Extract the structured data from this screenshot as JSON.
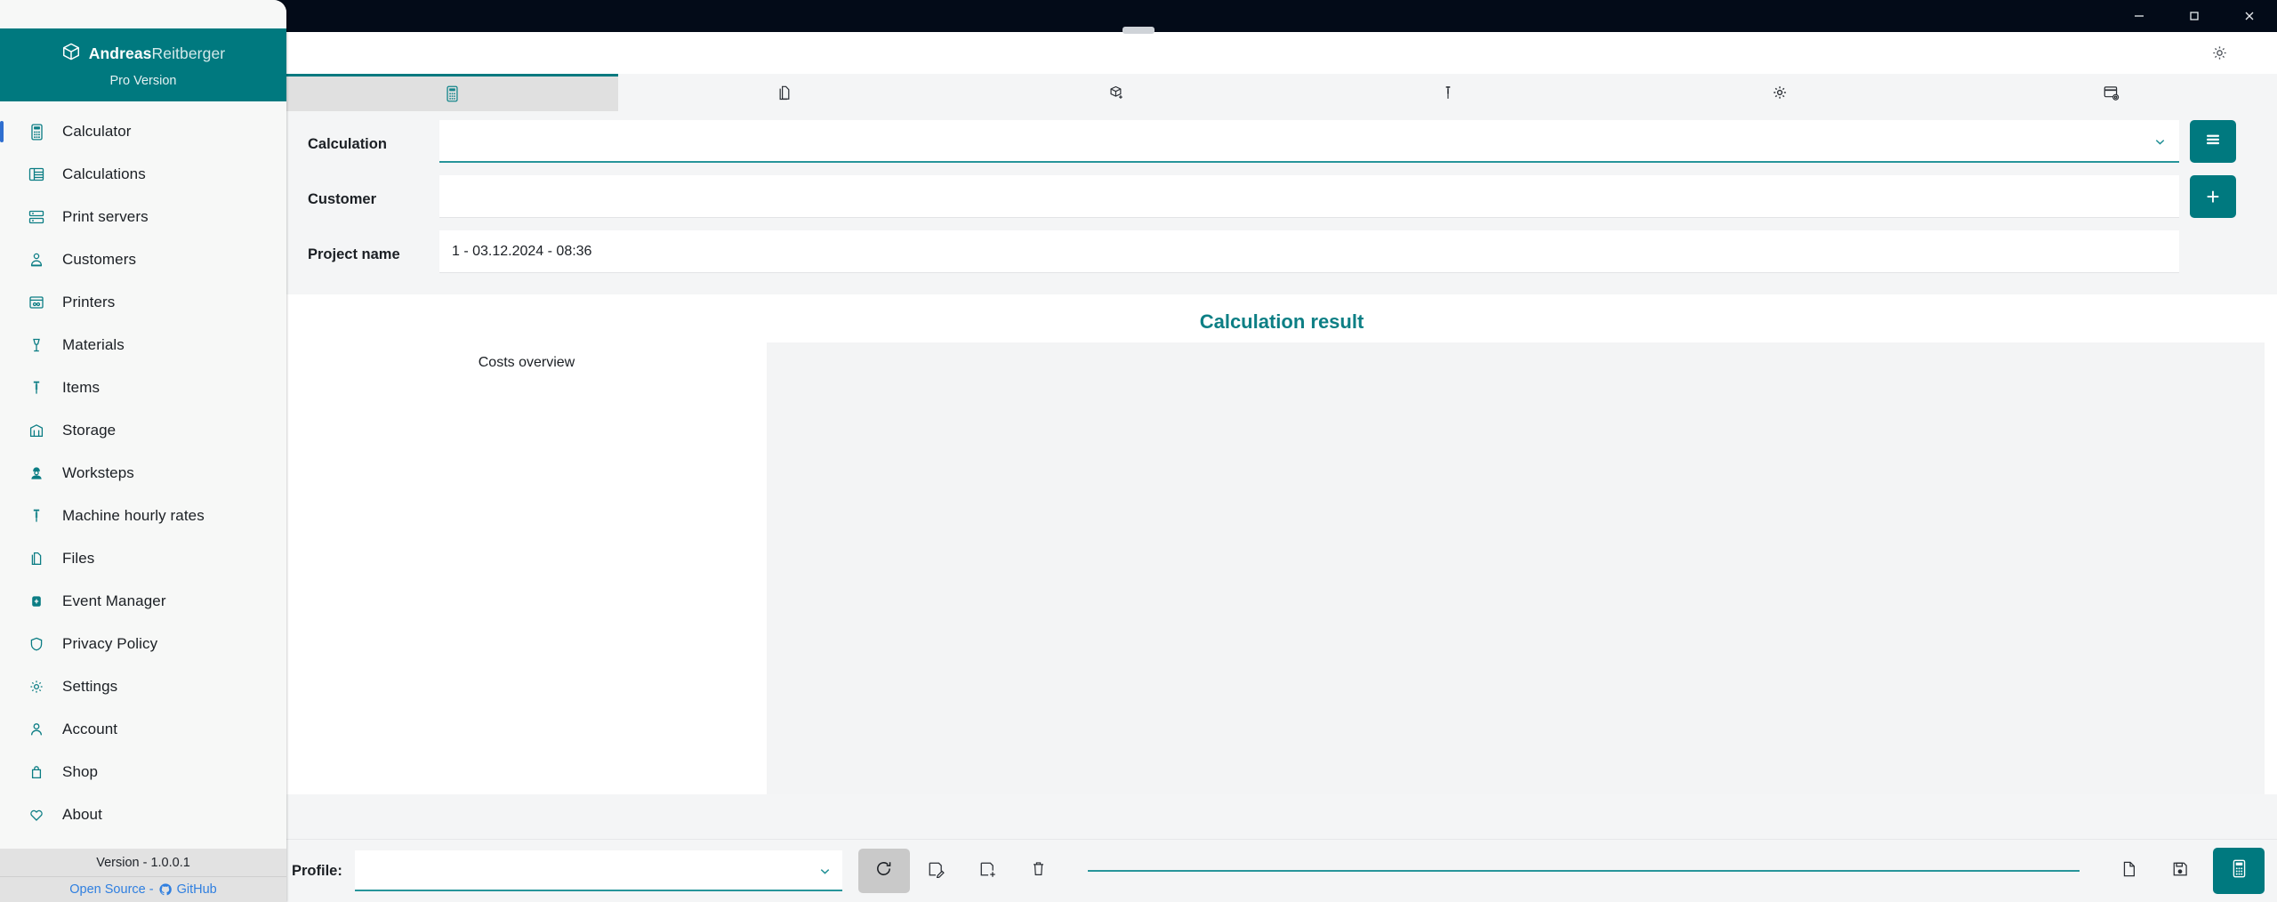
{
  "window": {
    "controls": [
      {
        "name": "minimize",
        "label": "–"
      },
      {
        "name": "maximize",
        "label": "□"
      },
      {
        "name": "close",
        "label": "✕"
      }
    ]
  },
  "sidebar": {
    "brand_bold": "Andreas",
    "brand_light": "Reitberger",
    "edition": "Pro Version",
    "items": [
      {
        "label": "Calculator",
        "icon": "calculator-icon",
        "active": true
      },
      {
        "label": "Calculations",
        "icon": "table-icon",
        "active": false
      },
      {
        "label": "Print servers",
        "icon": "server-icon",
        "active": false
      },
      {
        "label": "Customers",
        "icon": "user-badge-icon",
        "active": false
      },
      {
        "label": "Printers",
        "icon": "printer-icon",
        "active": false
      },
      {
        "label": "Materials",
        "icon": "material-icon",
        "active": false
      },
      {
        "label": "Items",
        "icon": "screw-icon",
        "active": false
      },
      {
        "label": "Storage",
        "icon": "storage-icon",
        "active": false
      },
      {
        "label": "Worksteps",
        "icon": "worker-icon",
        "active": false
      },
      {
        "label": "Machine hourly rates",
        "icon": "screw-icon",
        "active": false
      },
      {
        "label": "Files",
        "icon": "files-icon",
        "active": false
      },
      {
        "label": "Event Manager",
        "icon": "event-icon",
        "active": false
      },
      {
        "label": "Privacy Policy",
        "icon": "shield-icon",
        "active": false
      },
      {
        "label": "Settings",
        "icon": "gear-icon",
        "active": false
      },
      {
        "label": "Account",
        "icon": "user-icon",
        "active": false
      },
      {
        "label": "Shop",
        "icon": "bag-icon",
        "active": false
      },
      {
        "label": "About",
        "icon": "heart-icon",
        "active": false
      }
    ],
    "footer": {
      "version": "Version - 1.0.0.1",
      "open_source_prefix": "Open Source - ",
      "open_source_link": "GitHub"
    }
  },
  "topbar": {
    "settings_icon": "gear-icon"
  },
  "tabs": [
    {
      "name": "tab-calculator",
      "icon": "calculator-icon",
      "active": true
    },
    {
      "name": "tab-documents",
      "icon": "copy-document-icon",
      "active": false
    },
    {
      "name": "tab-materials",
      "icon": "cube-plus-icon",
      "active": false
    },
    {
      "name": "tab-items",
      "icon": "screw-icon",
      "active": false
    },
    {
      "name": "tab-settings",
      "icon": "gear-icon",
      "active": false
    },
    {
      "name": "tab-layout",
      "icon": "window-gear-icon",
      "active": false
    }
  ],
  "form": {
    "calculation": {
      "label": "Calculation",
      "value": "",
      "placeholder": "",
      "action_icon": "stack-layers-icon"
    },
    "customer": {
      "label": "Customer",
      "value": "",
      "placeholder": "",
      "action_label": "+"
    },
    "project_name": {
      "label": "Project name",
      "value": "1 - 03.12.2024 - 08:36",
      "placeholder": ""
    }
  },
  "result": {
    "title": "Calculation result",
    "costs_overview_label": "Costs overview"
  },
  "bottombar": {
    "profile_label": "Profile:",
    "profile_value": "",
    "profile_placeholder": "",
    "buttons": [
      {
        "name": "refresh-button",
        "icon": "refresh-icon"
      },
      {
        "name": "save-edit-button",
        "icon": "save-edit-icon"
      },
      {
        "name": "save-add-button",
        "icon": "save-add-icon"
      },
      {
        "name": "delete-button",
        "icon": "trash-icon"
      },
      {
        "name": "new-file-button",
        "icon": "file-icon"
      },
      {
        "name": "save-file-button",
        "icon": "floppy-disk-icon"
      },
      {
        "name": "calculate-button",
        "icon": "calculator-icon"
      }
    ]
  },
  "colors": {
    "brand_teal": "#00797f",
    "accent_teal": "#27959a",
    "title_bar": "#030b18",
    "sidebar_bg": "#f7f8f7",
    "link_blue": "#2f7fe0"
  }
}
